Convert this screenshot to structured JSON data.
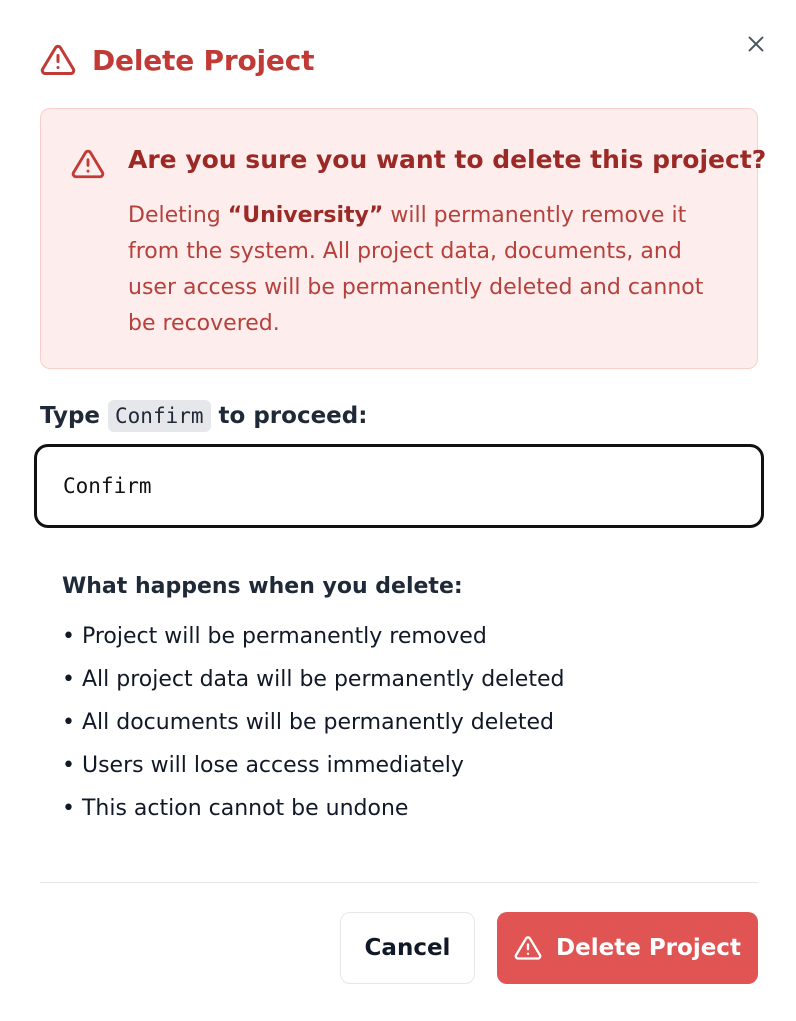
{
  "dialog": {
    "title": "Delete Project",
    "close_icon": "close-icon",
    "header_icon": "warning-triangle-icon",
    "accent_color": "#c23a35"
  },
  "warning": {
    "icon": "warning-triangle-icon",
    "title": "Are you sure you want to delete this project?",
    "text_prefix": "Deleting ",
    "project_name": "“University”",
    "text_suffix": " will permanently remove it from the system. All project data, documents, and user access will be permanently deleted and cannot be recovered.",
    "background_color": "#fdeeed",
    "text_color": "#b6403b"
  },
  "confirm": {
    "label_prefix": "Type",
    "keyword": "Confirm",
    "label_suffix": "to proceed:",
    "input_value": "Confirm"
  },
  "effects": {
    "title": "What happens when you delete:",
    "items": [
      "• Project will be permanently removed",
      "• All project data will be permanently deleted",
      "• All documents will be permanently deleted",
      "• Users will lose access immediately",
      "• This action cannot be undone"
    ]
  },
  "footer": {
    "cancel_label": "Cancel",
    "delete_label": "Delete Project",
    "delete_icon": "warning-triangle-icon",
    "delete_color": "#e05453"
  }
}
